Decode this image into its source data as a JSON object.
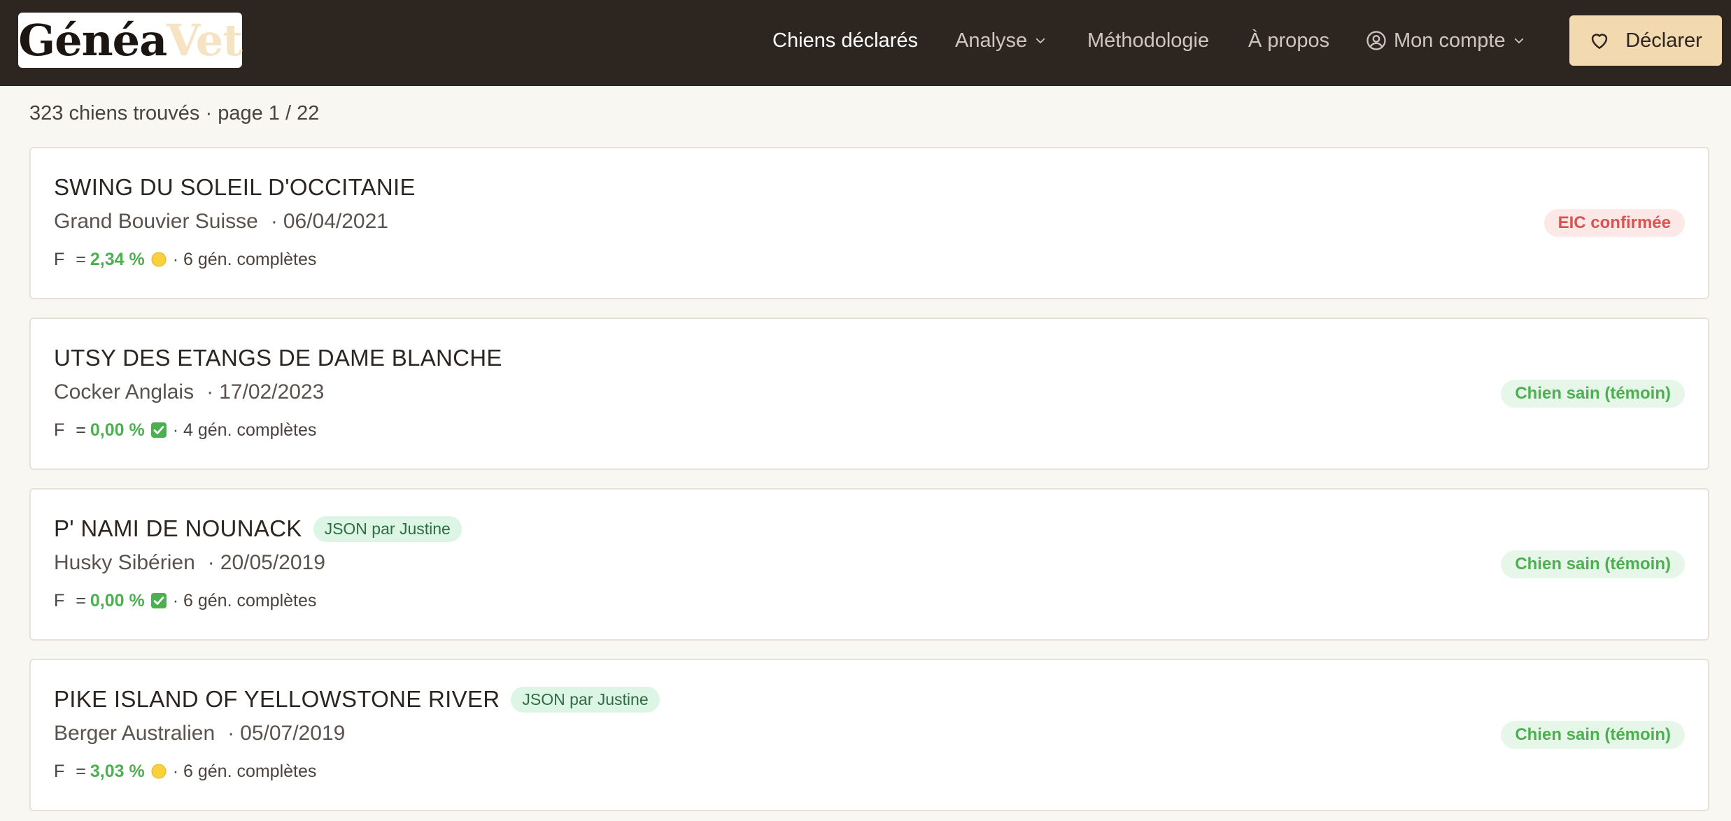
{
  "header": {
    "logo": {
      "part1": "Généa",
      "part2": "Vet"
    },
    "nav": {
      "declared_dogs": "Chiens déclarés",
      "analysis": "Analyse",
      "methodology": "Méthodologie",
      "about": "À propos",
      "account": "Mon compte"
    },
    "declare_button": "Déclarer"
  },
  "results": {
    "summary": "323 chiens trouvés · page 1 / 22"
  },
  "cards": [
    {
      "name": "SWING DU SOLEIL D'OCCITANIE",
      "badge": "",
      "breed": "Grand Bouvier Suisse",
      "date": "06/04/2021",
      "f_label": "F",
      "f_eq": "=",
      "f_value": "2,34 %",
      "f_icon": "yellow-circle-icon",
      "generations": "· 6 gén. complètes",
      "status": "EIC confirmée",
      "status_type": "danger"
    },
    {
      "name": "UTSY DES ETANGS DE DAME BLANCHE",
      "badge": "",
      "breed": "Cocker Anglais",
      "date": "17/02/2023",
      "f_label": "F",
      "f_eq": "=",
      "f_value": "0,00 %",
      "f_icon": "green-check-icon",
      "generations": "· 4 gén. complètes",
      "status": "Chien sain (témoin)",
      "status_type": "ok"
    },
    {
      "name": "P' NAMI DE NOUNACK",
      "badge": "JSON par Justine",
      "breed": "Husky Sibérien",
      "date": "20/05/2019",
      "f_label": "F",
      "f_eq": "=",
      "f_value": "0,00 %",
      "f_icon": "green-check-icon",
      "generations": "· 6 gén. complètes",
      "status": "Chien sain (témoin)",
      "status_type": "ok"
    },
    {
      "name": "PIKE ISLAND OF YELLOWSTONE RIVER",
      "badge": "JSON par Justine",
      "breed": "Berger Australien",
      "date": "05/07/2019",
      "f_label": "F",
      "f_eq": "=",
      "f_value": "3,03 %",
      "f_icon": "yellow-circle-icon",
      "generations": "· 6 gén. complètes",
      "status": "Chien sain (témoin)",
      "status_type": "ok"
    }
  ],
  "colors": {
    "header_bg": "#2d2520",
    "accent": "#f3d9b0",
    "page_bg": "#f8f7f1",
    "ok": "#4caf50",
    "danger": "#d9534f"
  }
}
